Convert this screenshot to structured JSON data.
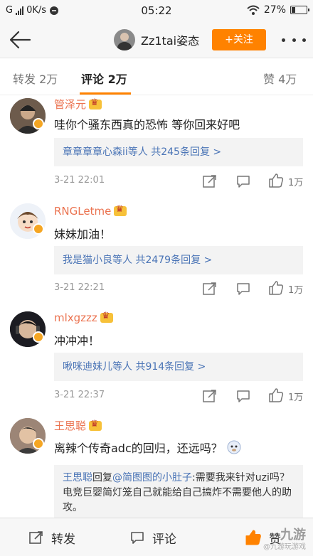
{
  "status_bar": {
    "carrier": "G",
    "speed": "0K/s",
    "time": "05:22",
    "battery": "27%",
    "battery_level": 0.27
  },
  "header": {
    "username": "Zz1tai姿态",
    "follow_label": "+关注"
  },
  "tabs": {
    "repost_label": "转发",
    "repost_count": "2万",
    "comment_label": "评论",
    "comment_count": "2万",
    "like_label": "赞",
    "like_count": "4万"
  },
  "comments": [
    {
      "name": "管泽元",
      "text": "哇你个骚东西真的恐怖 等你回来好吧",
      "replies": "章章章章心森ii等人 共245条回复 >",
      "time": "3-21 22:01",
      "likes": "1万"
    },
    {
      "name": "RNGLetme",
      "text": "妹妹加油！",
      "replies": "我是猫小良等人 共2479条回复 >",
      "time": "3-21 22:21",
      "likes": "1万"
    },
    {
      "name": "mlxgzzz",
      "text": "冲冲冲！",
      "replies": "啾咪迪妹儿等人 共914条回复 >",
      "time": "3-21 22:37",
      "likes": "1万"
    },
    {
      "name": "王思聪",
      "text": "离辣个传奇adc的回归，还远吗？",
      "reply_who": "王思聪",
      "reply_mid": "回复",
      "reply_target": "@简图图的小肚子",
      "reply_body": ":需要我来针对uzi吗？电竞巨婴简灯笼自己就能给自己搞炸不需要他人的助攻。"
    }
  ],
  "bottom_bar": {
    "repost_label": "转发",
    "comment_label": "评论",
    "like_label": "赞"
  },
  "watermark": {
    "main": "九游",
    "sub": "@九游玩游戏"
  },
  "colors": {
    "accent": "#ff8200",
    "name_color": "#eb7350",
    "link_color": "#4a74b6"
  }
}
